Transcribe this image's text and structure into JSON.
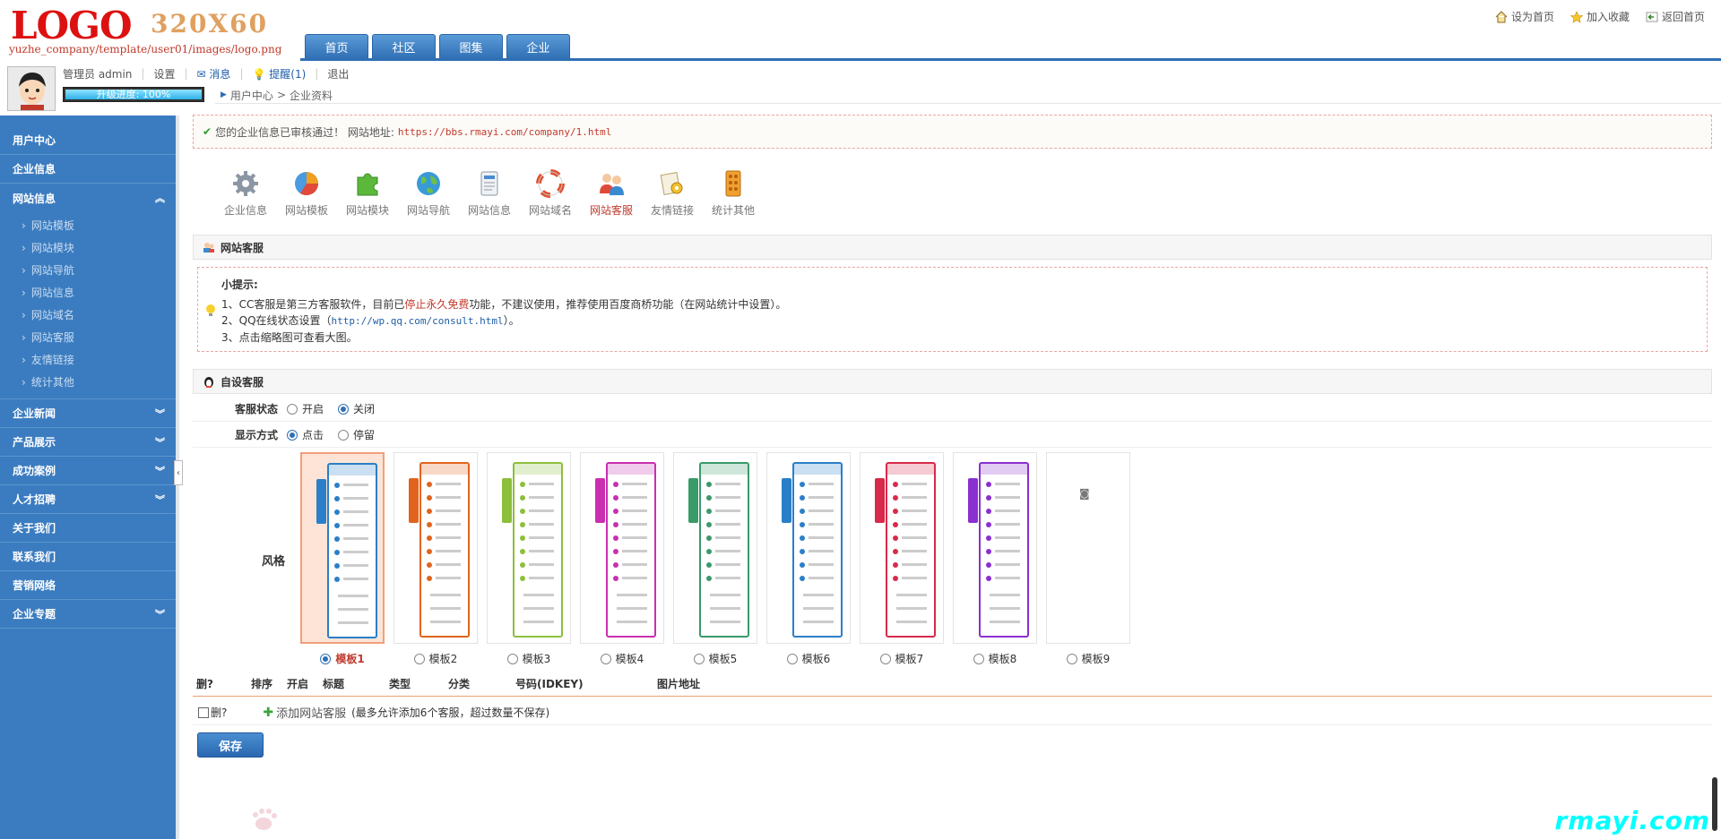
{
  "logo": {
    "big": "LOGO",
    "size": "320X60",
    "path": "yuzhe_company/template/user01/images/logo.png"
  },
  "main_nav": [
    "首页",
    "社区",
    "图集",
    "企业"
  ],
  "top_links": {
    "home": "设为首页",
    "fav": "加入收藏",
    "back": "返回首页"
  },
  "user": {
    "name": "管理员 admin",
    "settings": "设置",
    "messages": "消息",
    "reminder": "提醒(1)",
    "logout": "退出",
    "progress_text": "升级进度: 100%",
    "progress": 1.0
  },
  "breadcrumb": {
    "root": "用户中心",
    "current": "企业资料"
  },
  "sidebar": {
    "top": [
      "用户中心",
      "企业信息"
    ],
    "website": "网站信息",
    "website_sub": [
      "网站模板",
      "网站模块",
      "网站导航",
      "网站信息",
      "网站域名",
      "网站客服",
      "友情链接",
      "统计其他"
    ],
    "bottom": [
      {
        "label": "企业新闻",
        "chev": "︾"
      },
      {
        "label": "产品展示",
        "chev": "︾"
      },
      {
        "label": "成功案例",
        "chev": "︾"
      },
      {
        "label": "人才招聘",
        "chev": "︾"
      },
      {
        "label": "关于我们",
        "chev": ""
      },
      {
        "label": "联系我们",
        "chev": ""
      },
      {
        "label": "营销网络",
        "chev": ""
      },
      {
        "label": "企业专题",
        "chev": "︾"
      }
    ],
    "collapse": "︽"
  },
  "notice": {
    "text": "您的企业信息已审核通过！ 网站地址:",
    "url": "https://bbs.rmayi.com/company/1.html"
  },
  "toolbar": [
    {
      "label": "企业信息",
      "icon": "gear-icon"
    },
    {
      "label": "网站模板",
      "icon": "pie-icon"
    },
    {
      "label": "网站模块",
      "icon": "puzzle-icon"
    },
    {
      "label": "网站导航",
      "icon": "globe-icon"
    },
    {
      "label": "网站信息",
      "icon": "document-icon"
    },
    {
      "label": "网站域名",
      "icon": "lifebuoy-icon"
    },
    {
      "label": "网站客服",
      "icon": "users-icon"
    },
    {
      "label": "友情链接",
      "icon": "link-gear-icon"
    },
    {
      "label": "统计其他",
      "icon": "abacus-icon"
    }
  ],
  "panel_service": {
    "title": "网站客服"
  },
  "tips": {
    "title": "小提示:",
    "l1_a": "1、CC客服是第三方客服软件，目前已",
    "l1_red": "停止永久免费",
    "l1_b": "功能，不建议使用，推荐使用百度商桥功能（在网站统计中设置）。",
    "l2_a": "2、QQ在线状态设置（",
    "l2_url": "http://wp.qq.com/consult.html",
    "l2_b": "）。",
    "l3": "3、点击缩略图可查看大图。"
  },
  "panel_custom": {
    "title": "自设客服"
  },
  "status": {
    "label": "客服状态",
    "on": "开启",
    "off": "关闭"
  },
  "display": {
    "label": "显示方式",
    "click": "点击",
    "stay": "停留"
  },
  "style": {
    "label": "风格"
  },
  "templates": [
    {
      "label": "模板1",
      "color": "#2a7fc8"
    },
    {
      "label": "模板2",
      "color": "#e0641e"
    },
    {
      "label": "模板3",
      "color": "#8cbf3c"
    },
    {
      "label": "模板4",
      "color": "#c92fb0"
    },
    {
      "label": "模板5",
      "color": "#3a9a6a"
    },
    {
      "label": "模板6",
      "color": "#2a7fc8"
    },
    {
      "label": "模板7",
      "color": "#d82a4a"
    },
    {
      "label": "模板8",
      "color": "#8a2fd0"
    },
    {
      "label": "模板9",
      "color": ""
    }
  ],
  "table": {
    "del": "删?",
    "order": "排序",
    "enabled": "开启",
    "title": "标题",
    "type": "类型",
    "category": "分类",
    "number": "号码(IDKEY)",
    "image": "图片地址"
  },
  "add_row": {
    "del": "删?",
    "link": "添加网站客服",
    "note": "(最多允许添加6个客服，超过数量不保存)"
  },
  "save": "保存",
  "watermark": "rmayi.com"
}
